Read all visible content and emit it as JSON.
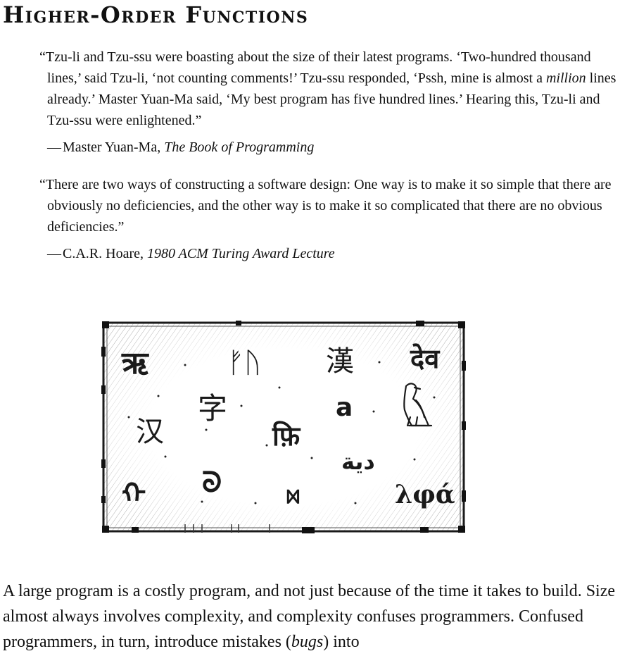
{
  "chapter": {
    "title": "Higher-Order Functions"
  },
  "epigraphs": [
    {
      "open_quote": "“",
      "text": "Tzu-li and Tzu-ssu were boasting about the size of their latest programs. ‘Two-hundred thousand lines,’ said Tzu-li, ‘not counting comments!’ Tzu-ssu responded, ‘Pssh, mine is almost a ",
      "emphasis": "million",
      "text_after": " lines already.’ Master Yuan-Ma said, ‘My best program has five hundred lines.’ Hearing this, Tzu-li and Tzu-ssu were enlightened.”",
      "dash": "—",
      "author": "Master Yuan-Ma, ",
      "source": "The Book of Programming"
    },
    {
      "open_quote": "“",
      "text": "There are two ways of constructing a software design: One way is to make it so simple that there are obviously no deficiencies, and the other way is to make it so complicated that there are no obvious deficiencies.”",
      "dash": "—",
      "author": "C.A.R. Hoare, ",
      "source": "1980 ACM Turing Award Lecture"
    }
  ],
  "illustration": {
    "glyphs": [
      "ऋ",
      "ᚠᚢ",
      "漢",
      "देव",
      "字",
      "a",
      "汉",
      "फ़ि",
      "دية",
      "ᠬ",
      "ᘐ",
      "ᢂ",
      "λφά"
    ]
  },
  "body": {
    "text_before": "A large program is a costly program, and not just because of the time it takes to build. Size almost always involves complexity, and complexity confuses programmers. Confused programmers, in turn, introduce mistakes (",
    "emphasis": "bugs",
    "text_after": ") into"
  }
}
